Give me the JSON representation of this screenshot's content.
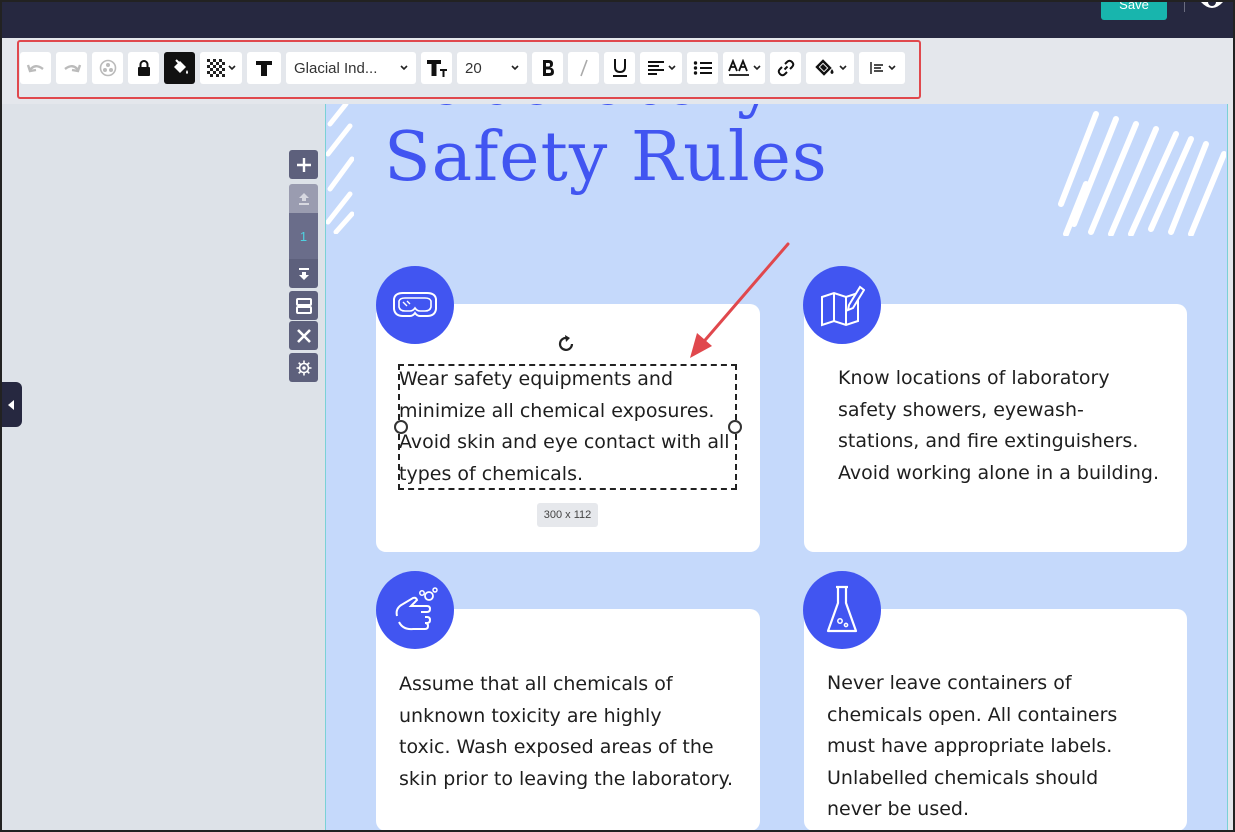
{
  "header": {
    "save_label": "Save"
  },
  "toolbar": {
    "font_family": "Glacial Ind...",
    "font_size": "20",
    "buttons": [
      "undo-icon",
      "redo-icon",
      "effects-icon",
      "lock-icon",
      "fill-bucket-icon",
      "transparency-icon",
      "text-icon",
      "font-size-icon",
      "bold-icon",
      "italic-icon",
      "underline-icon",
      "align-left-icon",
      "list-icon",
      "text-case-icon",
      "link-icon",
      "shape-fill-icon",
      "spacing-icon"
    ]
  },
  "page_controls": {
    "page_number": "1"
  },
  "canvas": {
    "title_line1": "Laboratory",
    "title_line2": "Safety Rules",
    "cards": [
      {
        "icon": "goggles-icon",
        "text": "Wear safety equipments and\nminimize all chemical exposures.\nAvoid skin and eye contact with all\ntypes of chemicals."
      },
      {
        "icon": "map-icon",
        "text": "Know locations of laboratory\nsafety showers, eyewash-\nstations, and fire extinguishers.\nAvoid working alone in a building."
      },
      {
        "icon": "hand-wash-icon",
        "text": "Assume that all chemicals of\nunknown toxicity are highly\ntoxic. Wash exposed areas of the\nskin prior to leaving the laboratory."
      },
      {
        "icon": "flask-icon",
        "text": "Never leave containers of\nchemicals open. All containers\nmust have appropriate labels.\nUnlabelled chemicals should\nnever be used."
      }
    ]
  },
  "selection": {
    "size_label": "300 x 112"
  },
  "colors": {
    "accent": "#4155f1",
    "canvas_bg": "#c5d9fb",
    "topbar": "#262840",
    "save": "#18b5ad",
    "highlight": "#e0484d"
  }
}
